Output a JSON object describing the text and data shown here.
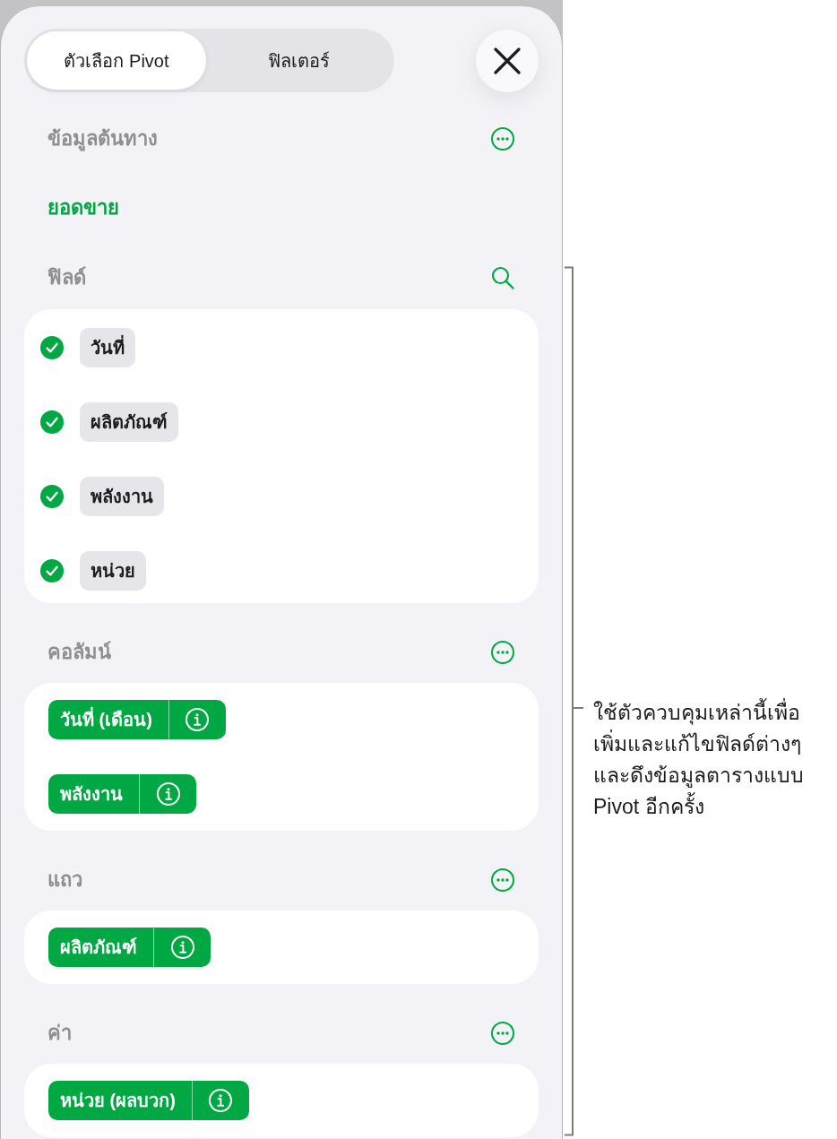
{
  "tabs": [
    {
      "label": "ตัวเลือก Pivot",
      "selected": true
    },
    {
      "label": "ฟิลเตอร์",
      "selected": false
    }
  ],
  "source": {
    "heading": "ข้อมูลต้นทาง",
    "name": "ยอดขาย"
  },
  "fields": {
    "heading": "ฟิลด์",
    "items": [
      {
        "label": "วันที่",
        "checked": true
      },
      {
        "label": "ผลิตภัณฑ์",
        "checked": true
      },
      {
        "label": "พลังงาน",
        "checked": true
      },
      {
        "label": "หน่วย",
        "checked": true
      }
    ]
  },
  "groups": [
    {
      "heading": "คอลัมน์",
      "items": [
        {
          "label": "วันที่ (เดือน)"
        },
        {
          "label": "พลังงาน"
        }
      ]
    },
    {
      "heading": "แถว",
      "items": [
        {
          "label": "ผลิตภัณฑ์"
        }
      ]
    },
    {
      "heading": "ค่า",
      "items": [
        {
          "label": "หน่วย (ผลบวก)"
        }
      ]
    }
  ],
  "callout": {
    "lines": [
      "ใช้ตัวควบคุมเหล่านี้เพื่อ",
      "เพิ่มและแก้ไขฟิลด์ต่างๆ",
      "และดึงข้อมูลตารางแบบ",
      "Pivot อีกครั้ง"
    ]
  }
}
